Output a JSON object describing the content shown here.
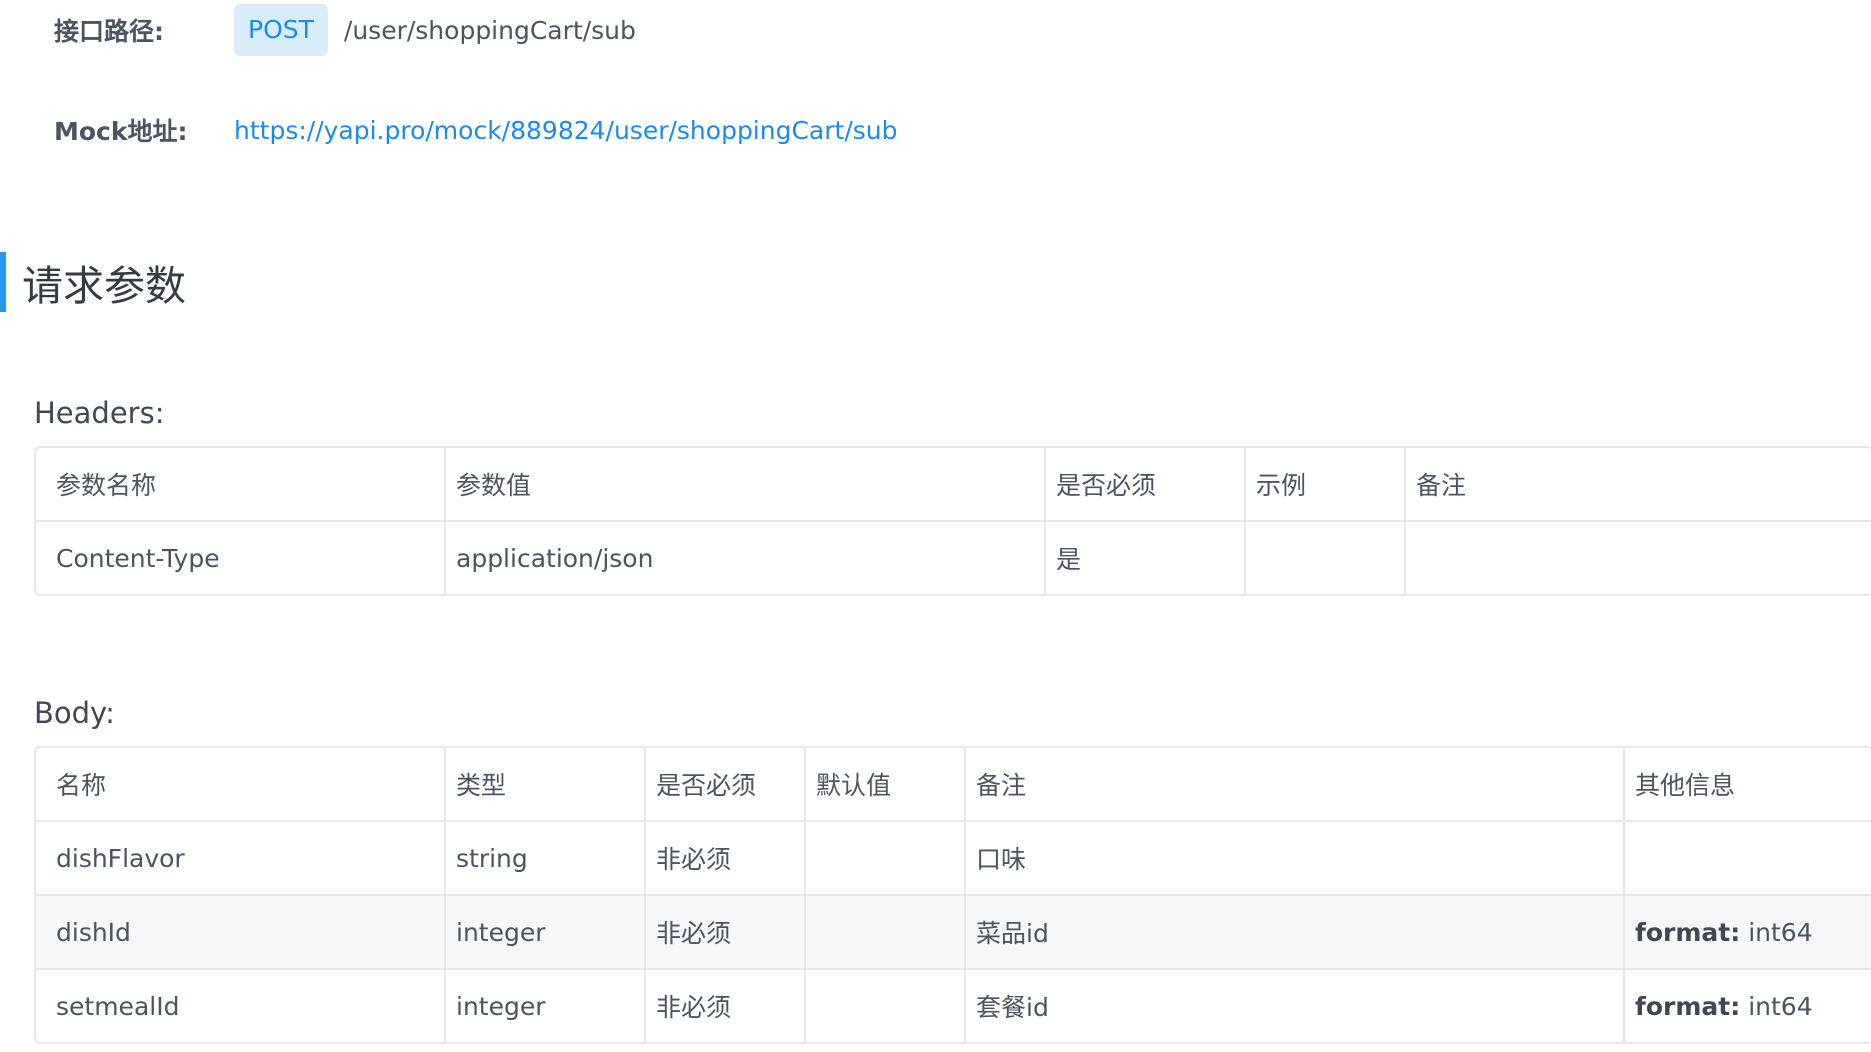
{
  "api_path": {
    "label": "接口路径:",
    "method": "POST",
    "path": "/user/shoppingCart/sub"
  },
  "mock": {
    "label": "Mock地址:",
    "url": "https://yapi.pro/mock/889824/user/shoppingCart/sub"
  },
  "section_title": "请求参数",
  "headers": {
    "title": "Headers:",
    "columns": [
      "参数名称",
      "参数值",
      "是否必须",
      "示例",
      "备注"
    ],
    "rows": [
      [
        "Content-Type",
        "application/json",
        "是",
        "",
        ""
      ]
    ]
  },
  "body": {
    "title": "Body:",
    "columns": [
      "名称",
      "类型",
      "是否必须",
      "默认值",
      "备注",
      "其他信息"
    ],
    "rows": [
      {
        "name": "dishFlavor",
        "type": "string",
        "required": "非必须",
        "default": "",
        "remark": "口味",
        "extra_key": "",
        "extra_val": ""
      },
      {
        "name": "dishId",
        "type": "integer",
        "required": "非必须",
        "default": "",
        "remark": "菜品id",
        "extra_key": "format:",
        "extra_val": " int64"
      },
      {
        "name": "setmealId",
        "type": "integer",
        "required": "非必须",
        "default": "",
        "remark": "套餐id",
        "extra_key": "format:",
        "extra_val": " int64"
      }
    ]
  },
  "colors": {
    "accent": "#1a8ce8",
    "badge_bg": "#d8ecfb",
    "section_bar": "#2196f3",
    "border": "#e6e8eb",
    "stripe": "#f6f7f8"
  }
}
